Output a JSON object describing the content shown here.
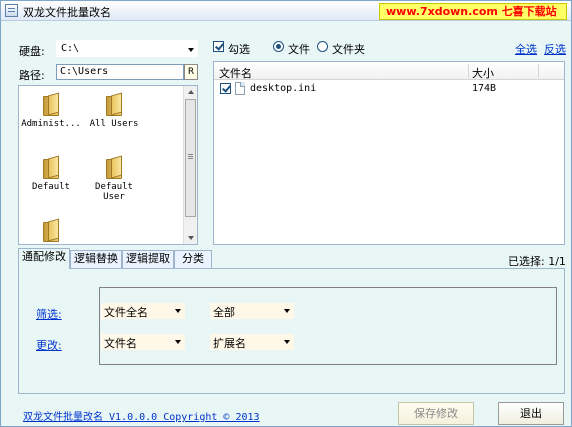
{
  "window": {
    "title": "双龙文件批量改名",
    "watermark": "www.7xdown.com 七喜下载站"
  },
  "left": {
    "drive_label": "硬盘:",
    "drive_value": "C:\\",
    "path_label": "路径:",
    "path_value": "C:\\Users",
    "path_btn": "R",
    "folders": [
      {
        "name": "Administ..."
      },
      {
        "name": "All Users"
      },
      {
        "name": "Default"
      },
      {
        "name": "Default User"
      },
      {
        "name": ""
      }
    ]
  },
  "right": {
    "check_label": "勾选",
    "radio_file": "文件",
    "radio_folder": "文件夹",
    "select_all": "全选",
    "invert_select": "反选",
    "columns": [
      "文件名",
      "大小"
    ],
    "files": [
      {
        "name": "desktop.ini",
        "size": "174B",
        "checked": true
      }
    ],
    "selected_count": "已选择: 1/1"
  },
  "tabs": [
    "通配修改",
    "逻辑替换",
    "逻辑提取",
    "分类"
  ],
  "panel": {
    "filter_label": "筛选:",
    "filter_combo1": "文件全名",
    "filter_combo2": "全部",
    "change_label": "更改:",
    "change_combo1": "文件名",
    "change_combo2": "扩展名"
  },
  "footer": {
    "about": "双龙文件批量改名  V1.0.0.0  Copyright ©  2013",
    "save": "保存修改",
    "exit": "退出"
  },
  "colors": {
    "background": "#e8f7f6",
    "watermark_bg": "#ffff66",
    "watermark_text": "#ff0000",
    "link": "#0033cc"
  }
}
